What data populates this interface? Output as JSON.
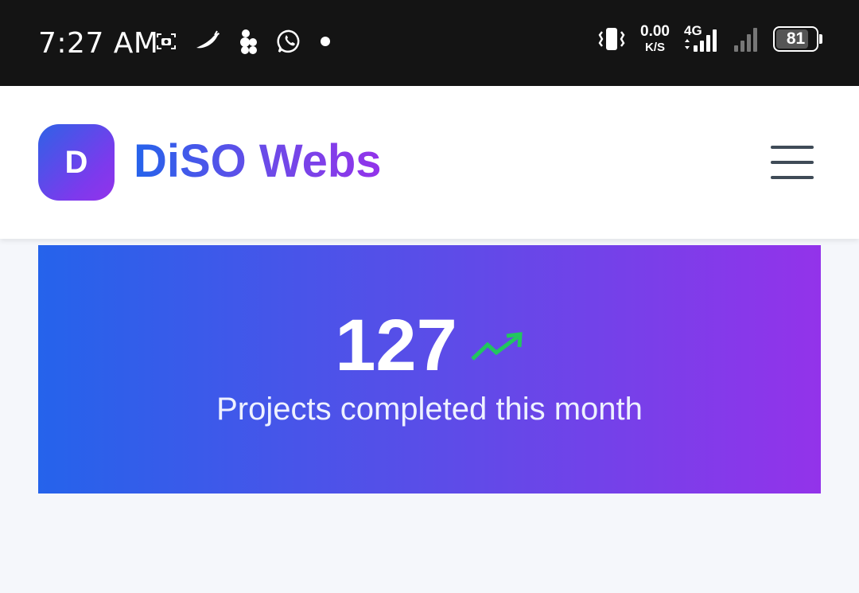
{
  "status_bar": {
    "time": "7:27 AM",
    "left_icons": [
      "screenshot-icon",
      "chili-icon",
      "app-cluster-icon",
      "whatsapp-icon",
      "notification-dot-icon"
    ],
    "vibrate_icon": "vibrate-icon",
    "net_speed_value": "0.00",
    "net_speed_unit": "K/S",
    "network_type": "4G",
    "battery_level": "81",
    "battery_fraction": 0.81
  },
  "header": {
    "logo_letter": "D",
    "brand_name": "DiSO Webs",
    "menu_icon": "hamburger-menu-icon"
  },
  "stats": {
    "value": "127",
    "trend_icon": "trending-up-icon",
    "caption": "Projects completed this month"
  },
  "colors": {
    "status_bar_bg": "#141414",
    "brand_start": "#2563eb",
    "brand_end": "#9333ea",
    "trend_green": "#22c55e",
    "menu_icon": "#3f4b57",
    "page_bg": "#f5f7fb"
  }
}
